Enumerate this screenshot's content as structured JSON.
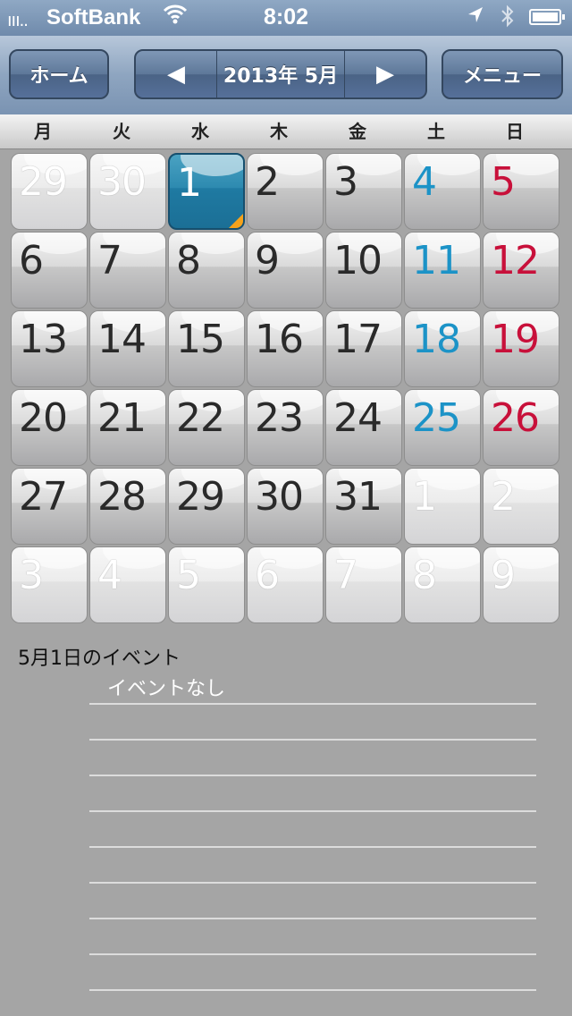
{
  "status": {
    "signal": "ııı..",
    "carrier": "SoftBank",
    "time": "8:02"
  },
  "nav": {
    "home_label": "ホーム",
    "prev_glyph": "◀",
    "title": "2013年 5月",
    "next_glyph": "▶",
    "menu_label": "メニュー"
  },
  "weekdays": [
    "月",
    "火",
    "水",
    "木",
    "金",
    "土",
    "日"
  ],
  "calendar": {
    "weeks": [
      [
        {
          "d": "29",
          "t": "dim"
        },
        {
          "d": "30",
          "t": "dim"
        },
        {
          "d": "1",
          "t": "sel"
        },
        {
          "d": "2",
          "t": ""
        },
        {
          "d": "3",
          "t": ""
        },
        {
          "d": "4",
          "t": "sat"
        },
        {
          "d": "5",
          "t": "sun"
        }
      ],
      [
        {
          "d": "6",
          "t": ""
        },
        {
          "d": "7",
          "t": ""
        },
        {
          "d": "8",
          "t": ""
        },
        {
          "d": "9",
          "t": ""
        },
        {
          "d": "10",
          "t": ""
        },
        {
          "d": "11",
          "t": "sat"
        },
        {
          "d": "12",
          "t": "sun"
        }
      ],
      [
        {
          "d": "13",
          "t": ""
        },
        {
          "d": "14",
          "t": ""
        },
        {
          "d": "15",
          "t": ""
        },
        {
          "d": "16",
          "t": ""
        },
        {
          "d": "17",
          "t": ""
        },
        {
          "d": "18",
          "t": "sat"
        },
        {
          "d": "19",
          "t": "sun"
        }
      ],
      [
        {
          "d": "20",
          "t": ""
        },
        {
          "d": "21",
          "t": ""
        },
        {
          "d": "22",
          "t": ""
        },
        {
          "d": "23",
          "t": ""
        },
        {
          "d": "24",
          "t": ""
        },
        {
          "d": "25",
          "t": "sat"
        },
        {
          "d": "26",
          "t": "sun"
        }
      ],
      [
        {
          "d": "27",
          "t": ""
        },
        {
          "d": "28",
          "t": ""
        },
        {
          "d": "29",
          "t": ""
        },
        {
          "d": "30",
          "t": ""
        },
        {
          "d": "31",
          "t": ""
        },
        {
          "d": "1",
          "t": "dim"
        },
        {
          "d": "2",
          "t": "dim"
        }
      ],
      [
        {
          "d": "3",
          "t": "dim"
        },
        {
          "d": "4",
          "t": "dim"
        },
        {
          "d": "5",
          "t": "dim"
        },
        {
          "d": "6",
          "t": "dim"
        },
        {
          "d": "7",
          "t": "dim"
        },
        {
          "d": "8",
          "t": "dim"
        },
        {
          "d": "9",
          "t": "dim"
        }
      ]
    ]
  },
  "events": {
    "title": "5月1日のイベント",
    "empty": "イベントなし"
  },
  "colors": {
    "saturday": "#1c93c7",
    "sunday": "#c8103a",
    "selected": "#2d8ab0",
    "marker": "#f5a21b"
  }
}
